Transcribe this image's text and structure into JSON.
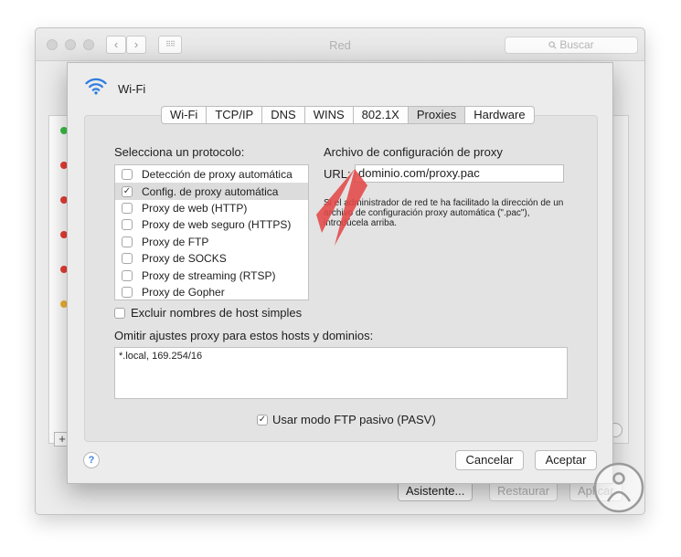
{
  "background_window": {
    "title": "Red",
    "search_placeholder": "Buscar",
    "nav_back": "‹",
    "nav_forward": "›",
    "grid_label": "⠿⠿",
    "add_label": "+",
    "buttons": {
      "assistant": "Asistente...",
      "restore": "Restaurar",
      "apply": "Aplicar"
    },
    "status_dots": [
      "#3cbf46",
      "#ea3d36",
      "#ea3d36",
      "#ea3d36",
      "#ea3d36",
      "#f2b335"
    ]
  },
  "sheet": {
    "icon": "wifi-icon",
    "title": "Wi-Fi",
    "tabs": [
      {
        "label": "Wi-Fi",
        "selected": false
      },
      {
        "label": "TCP/IP",
        "selected": false
      },
      {
        "label": "DNS",
        "selected": false
      },
      {
        "label": "WINS",
        "selected": false
      },
      {
        "label": "802.1X",
        "selected": false
      },
      {
        "label": "Proxies",
        "selected": true
      },
      {
        "label": "Hardware",
        "selected": false
      }
    ],
    "protocol_label": "Selecciona un protocolo:",
    "protocols": [
      {
        "label": "Detección de proxy automática",
        "checked": false,
        "selected": false
      },
      {
        "label": "Config. de proxy automática",
        "checked": true,
        "selected": true
      },
      {
        "label": "Proxy de web (HTTP)",
        "checked": false,
        "selected": false
      },
      {
        "label": "Proxy de web seguro (HTTPS)",
        "checked": false,
        "selected": false
      },
      {
        "label": "Proxy de FTP",
        "checked": false,
        "selected": false
      },
      {
        "label": "Proxy de SOCKS",
        "checked": false,
        "selected": false
      },
      {
        "label": "Proxy de streaming (RTSP)",
        "checked": false,
        "selected": false
      },
      {
        "label": "Proxy de Gopher",
        "checked": false,
        "selected": false
      }
    ],
    "config_title": "Archivo de configuración de proxy",
    "url_label": "URL:",
    "url_value": "dominio.com/proxy.pac",
    "help_text": "Si el administrador de red te ha facilitado la dirección de un archivo de configuración proxy automática (\".pac\"), introdúcela arriba.",
    "exclude_simple_label": "Excluir nombres de host simples",
    "exclude_simple_checked": false,
    "bypass_label": "Omitir ajustes proxy para estos hosts y dominios:",
    "bypass_value": "*.local, 169.254/16",
    "pasv_label": "Usar modo FTP pasivo (PASV)",
    "pasv_checked": true,
    "help_button": "?",
    "cancel_label": "Cancelar",
    "accept_label": "Aceptar",
    "checkmark": "✓",
    "accent_color": "#2f7de1",
    "arrow_color": "#e24848"
  }
}
